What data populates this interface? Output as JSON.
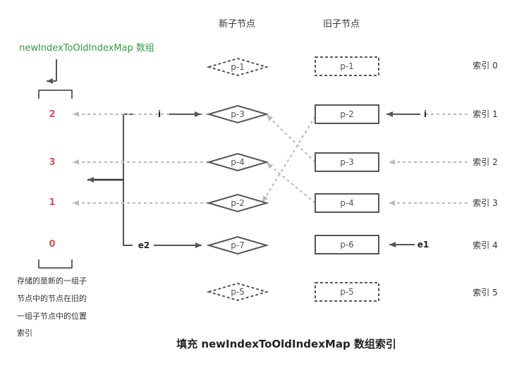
{
  "headers": {
    "new_nodes": "新子节点",
    "old_nodes": "旧子节点"
  },
  "map_label": "newIndexToOldIndexMap 数组",
  "map_values": [
    "2",
    "3",
    "1",
    "0"
  ],
  "map_note": [
    "存储的是新的一组子",
    "节点中的节点在旧的",
    "一组子节点中的位置",
    "索引"
  ],
  "new_children": [
    "p-1",
    "p-3",
    "p-4",
    "p-2",
    "p-7",
    "p-5"
  ],
  "old_children": [
    "p-1",
    "p-2",
    "p-3",
    "p-4",
    "p-6",
    "p-5"
  ],
  "index_labels": [
    "索引 0",
    "索引 1",
    "索引 2",
    "索引 3",
    "索引 4",
    "索引 5"
  ],
  "pointers": {
    "i_new": "i",
    "i_old": "i",
    "e2": "e2",
    "e1": "e1"
  },
  "title": "填充 newIndexToOldIndexMap 数组索引",
  "colors": {
    "map_value": "#e05252",
    "map_label": "#2e9e3e",
    "dashed_arrow": "#bbbbbb",
    "solid_arrow": "#555555"
  }
}
